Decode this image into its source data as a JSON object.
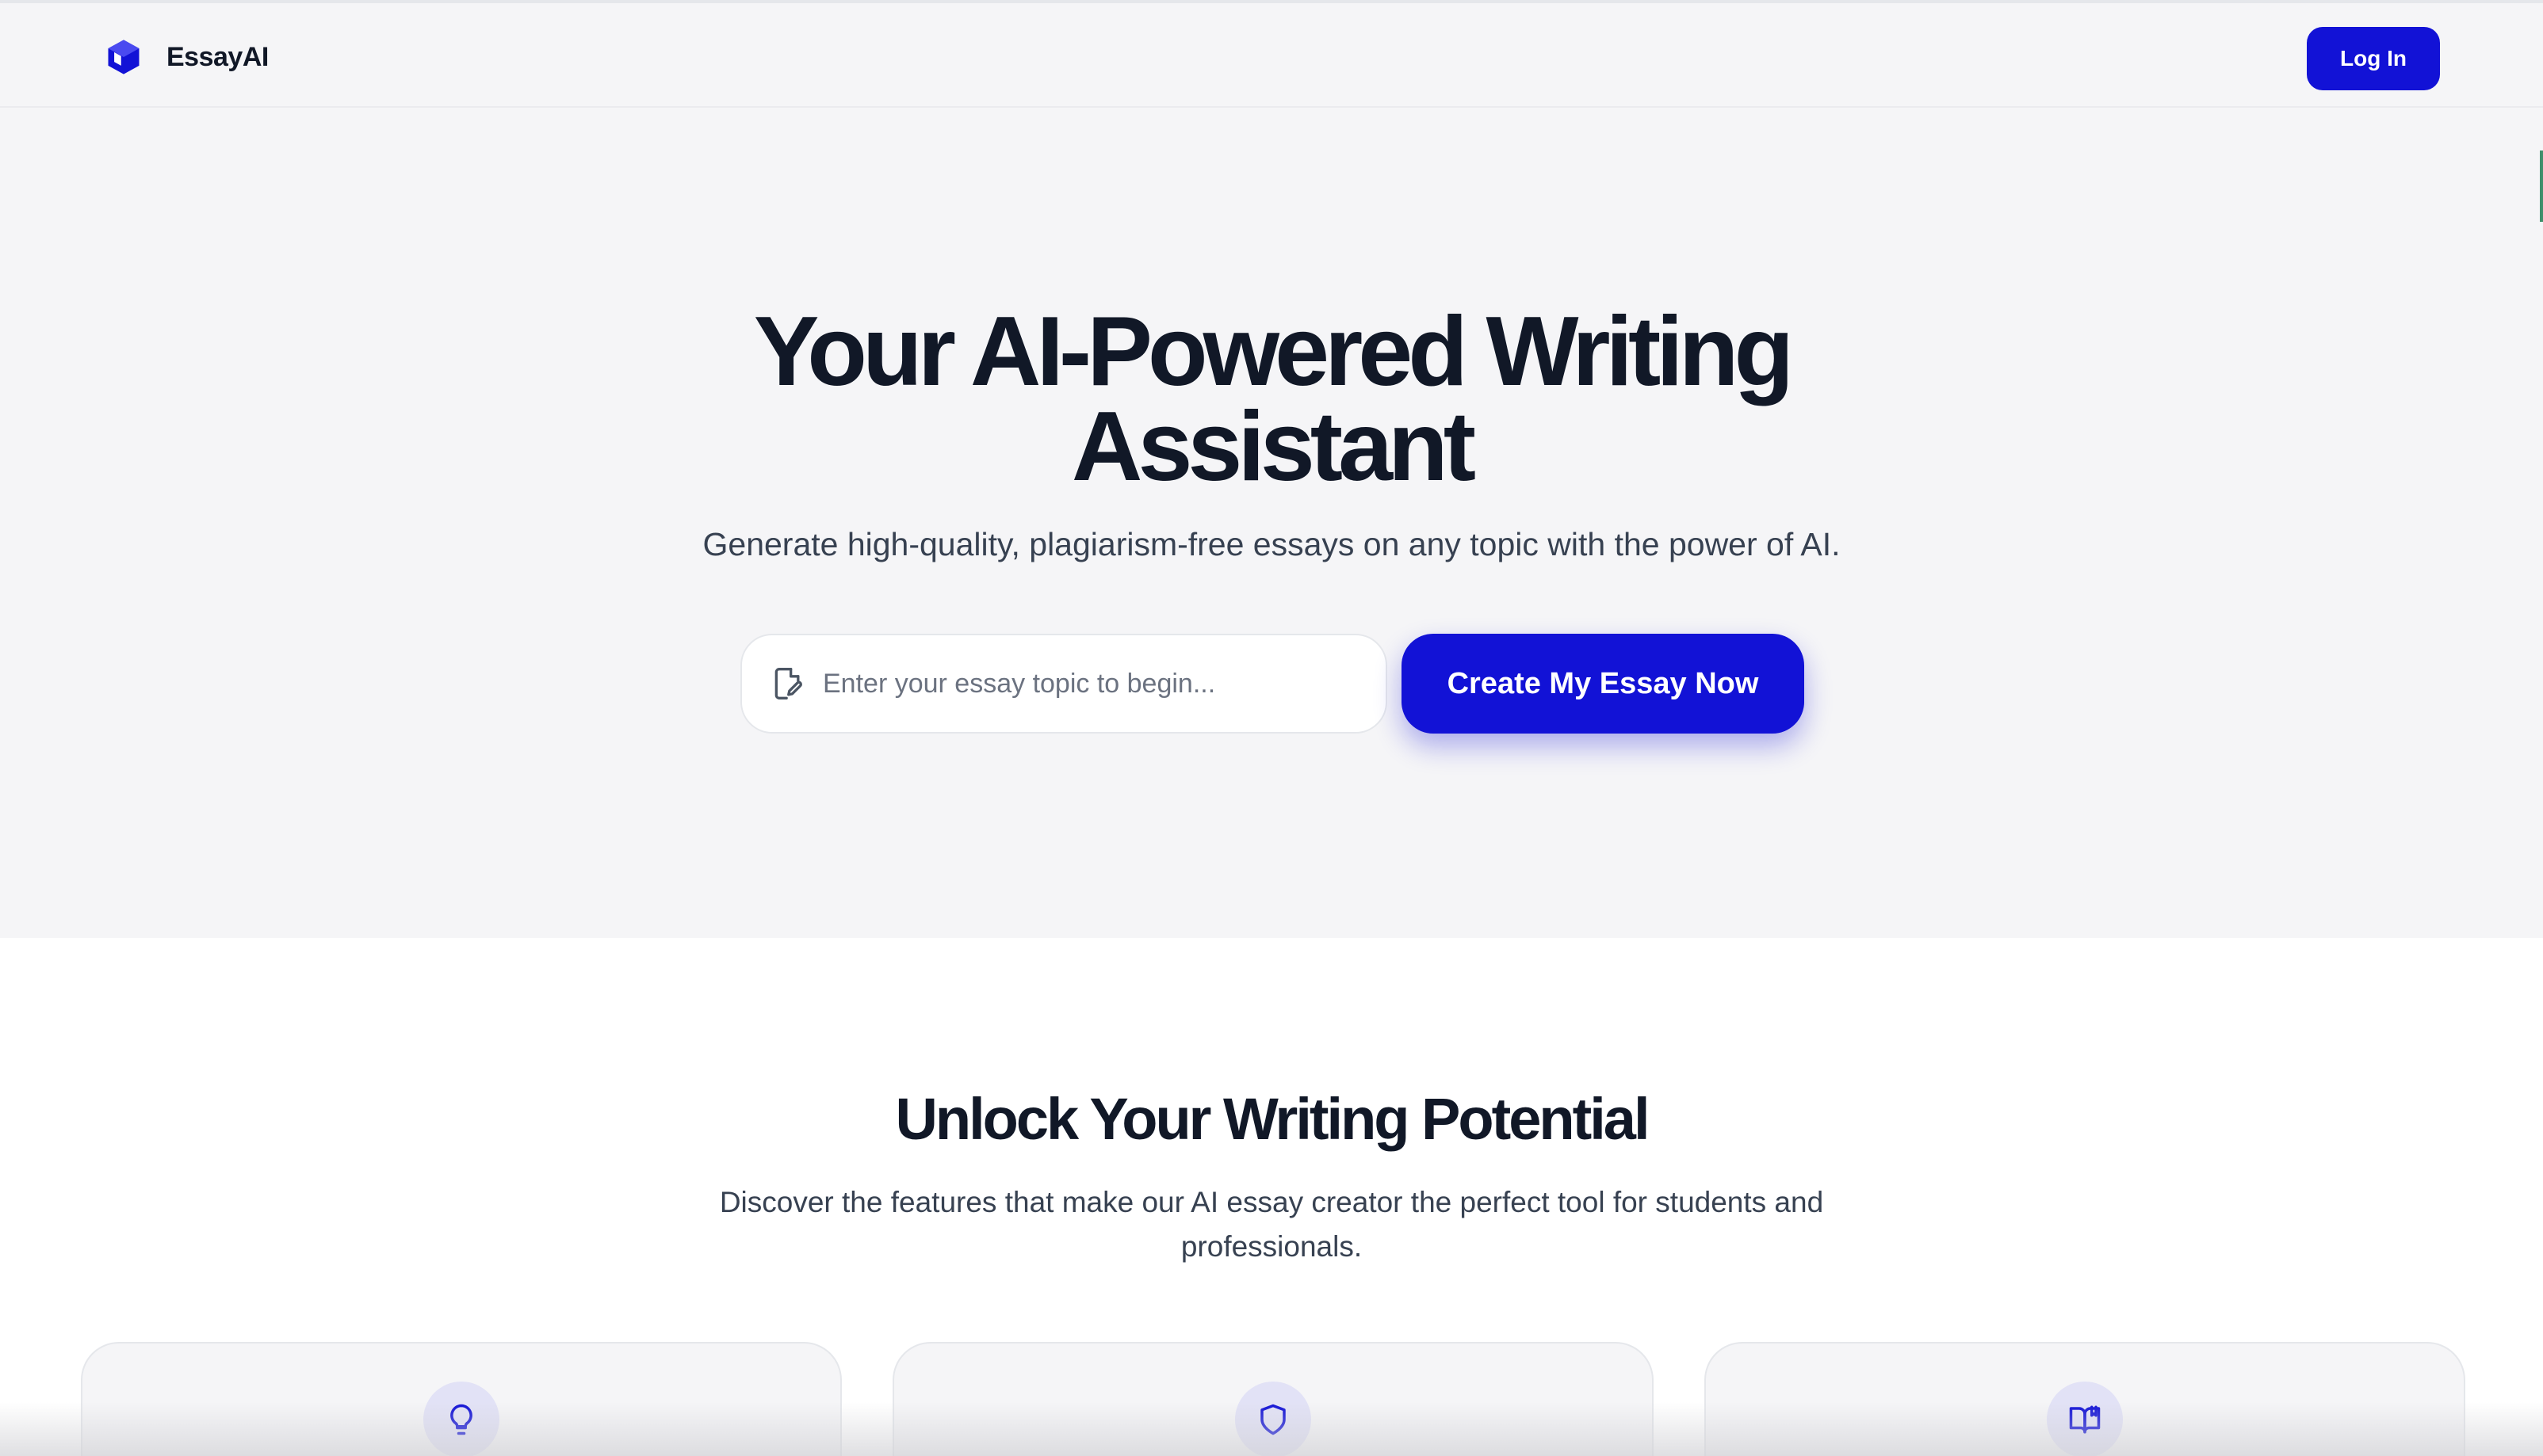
{
  "header": {
    "brand_name": "EssayAI",
    "login_label": "Log In",
    "logo_icon": "cube-icon"
  },
  "hero": {
    "title_line1": "Your AI-Powered Writing",
    "title_line2": "Assistant",
    "subtitle": "Generate high-quality, plagiarism-free essays on any topic with the power of AI.",
    "topic_input": {
      "placeholder": "Enter your essay topic to begin...",
      "value": "",
      "icon": "document-edit-icon"
    },
    "cta_label": "Create My Essay Now"
  },
  "features": {
    "title": "Unlock Your Writing Potential",
    "subtitle": "Discover the features that make our AI essay creator the perfect tool for students and professionals.",
    "cards": [
      {
        "icon": "lightbulb-icon"
      },
      {
        "icon": "shield-icon"
      },
      {
        "icon": "book-open-icon"
      }
    ]
  },
  "colors": {
    "accent": "#1212d6",
    "text_dark": "#111827",
    "text_muted": "#374151",
    "hero_bg": "#f5f5f7"
  }
}
